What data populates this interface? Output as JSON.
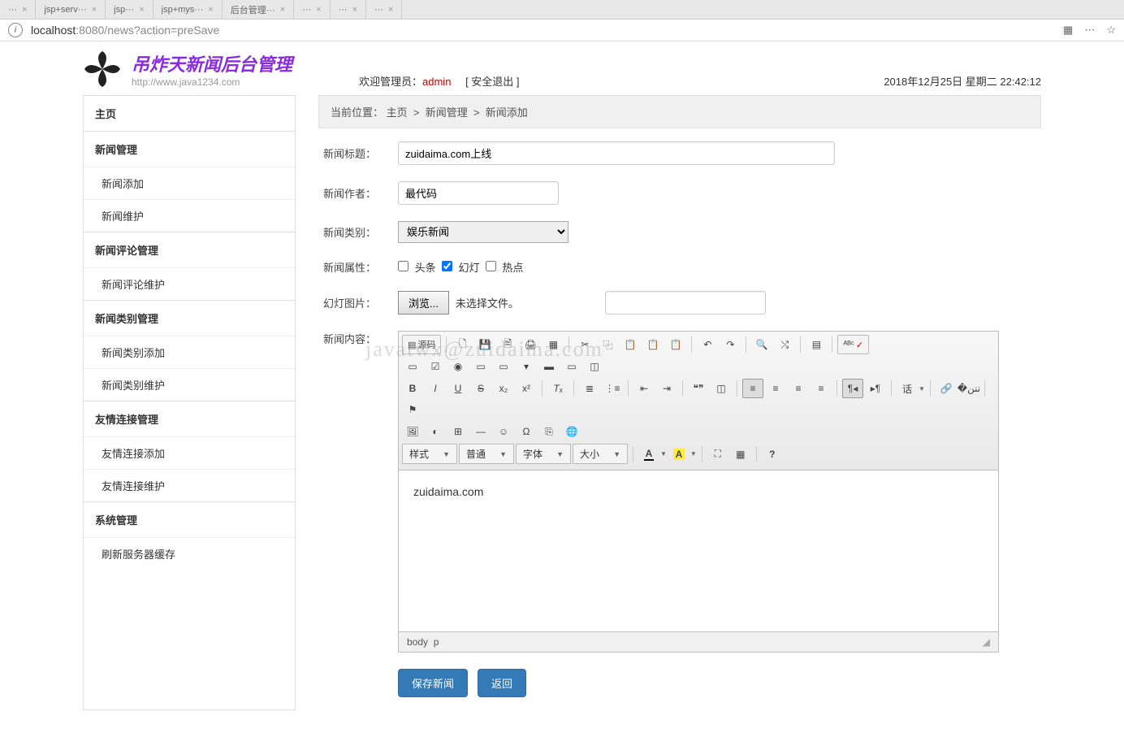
{
  "browser": {
    "tabs": [
      {
        "title": "···"
      },
      {
        "title": "jsp+serv···"
      },
      {
        "title": "jsp···"
      },
      {
        "title": "jsp+mys···"
      },
      {
        "title": "后台管理···"
      },
      {
        "title": "···"
      },
      {
        "title": "···"
      },
      {
        "title": "···"
      }
    ],
    "url_host": "localhost",
    "url_rest": ":8080/news?action=preSave"
  },
  "logo": {
    "title": "吊炸天新闻后台管理",
    "subtitle": "http://www.java1234.com"
  },
  "header": {
    "welcome_prefix": "欢迎管理员：",
    "admin": "admin",
    "logout": "[ 安全退出 ]",
    "datetime": "2018年12月25日 星期二 22:42:12"
  },
  "sidebar": {
    "home": "主页",
    "g1": "新闻管理",
    "g1a": "新闻添加",
    "g1b": "新闻维护",
    "g2": "新闻评论管理",
    "g2a": "新闻评论维护",
    "g3": "新闻类别管理",
    "g3a": "新闻类别添加",
    "g3b": "新闻类别维护",
    "g4": "友情连接管理",
    "g4a": "友情连接添加",
    "g4b": "友情连接维护",
    "g5": "系统管理",
    "g5a": "刷新服务器缓存"
  },
  "breadcrumb": {
    "prefix": "当前位置：",
    "p1": "主页",
    "sep": ">",
    "p2": "新闻管理",
    "p3": "新闻添加"
  },
  "form": {
    "title_label": "新闻标题：",
    "title_value": "zuidaima.com上线",
    "author_label": "新闻作者：",
    "author_value": "最代码",
    "cat_label": "新闻类别：",
    "cat_value": "娱乐新闻",
    "attr_label": "新闻属性：",
    "attr_opts": {
      "a": "头条",
      "b": "幻灯",
      "c": "热点"
    },
    "slide_label": "幻灯图片：",
    "browse": "浏览...",
    "nofile": "未选择文件。",
    "content_label": "新闻内容："
  },
  "toolbar": {
    "source": "源码",
    "style": "样式",
    "format": "普通",
    "font": "字体",
    "size": "大小",
    "lang": "话"
  },
  "editor": {
    "body": "zuidaima.com",
    "status_body": "body",
    "status_p": "p",
    "resize": "◢"
  },
  "actions": {
    "save": "保存新闻",
    "back": "返回"
  },
  "watermark": "javatwx@zuidaima.com"
}
